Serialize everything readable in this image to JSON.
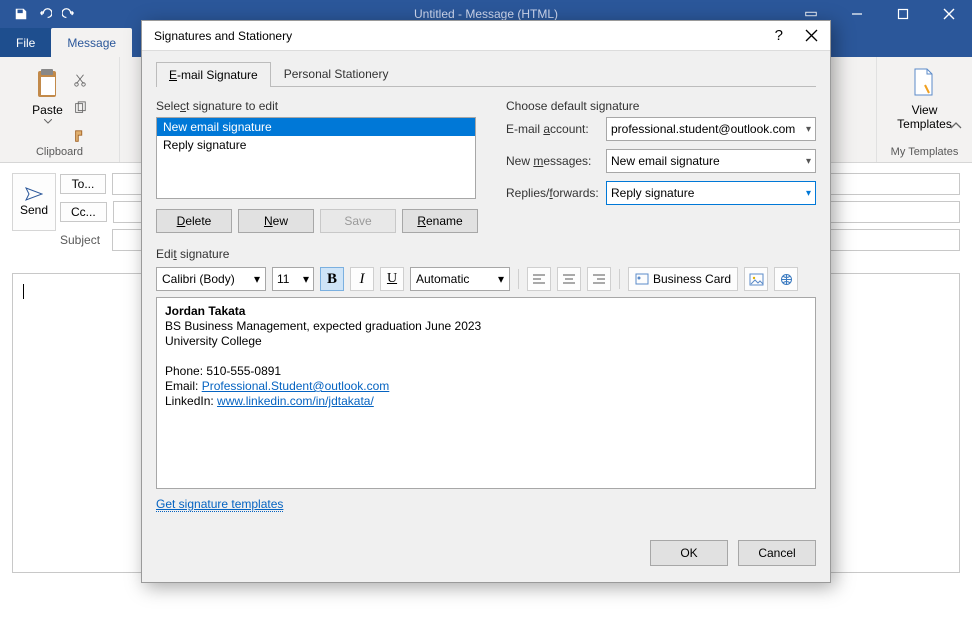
{
  "window": {
    "title": "Untitled - Message (HTML)"
  },
  "tabs": {
    "file": "File",
    "message": "Message"
  },
  "ribbon": {
    "clipboard": {
      "paste": "Paste",
      "group": "Clipboard"
    },
    "templates": {
      "view": "View\nTemplates",
      "group": "My Templates"
    }
  },
  "compose": {
    "send": "Send",
    "to": "To...",
    "cc": "Cc...",
    "subject": "Subject"
  },
  "dialog": {
    "title": "Signatures and Stationery",
    "tabs": {
      "email": "E-mail Signature",
      "stationery": "Personal Stationery"
    },
    "select_label": "Select signature to edit",
    "sig_items": [
      "New email signature",
      "Reply signature"
    ],
    "buttons": {
      "delete": "Delete",
      "new": "New",
      "save": "Save",
      "rename": "Rename"
    },
    "defaults": {
      "label": "Choose default signature",
      "account_label": "E-mail account:",
      "account": "professional.student@outlook.com",
      "new_label": "New messages:",
      "new": "New email signature",
      "reply_label": "Replies/forwards:",
      "reply": "Reply signature"
    },
    "edit_label": "Edit signature",
    "toolbar": {
      "font": "Calibri (Body)",
      "size": "11",
      "color": "Automatic",
      "bcard": "Business Card"
    },
    "signature": {
      "name": "Jordan Takata",
      "line2": "BS Business Management, expected graduation June 2023",
      "line3": "University College",
      "phone_label": "Phone: ",
      "phone": "510-555-0891",
      "email_label": "Email: ",
      "email": "Professional.Student@outlook.com",
      "linkedin_label": "LinkedIn: ",
      "linkedin": "www.linkedin.com/in/jdtakata/"
    },
    "get_templates": "Get signature templates",
    "ok": "OK",
    "cancel": "Cancel"
  }
}
